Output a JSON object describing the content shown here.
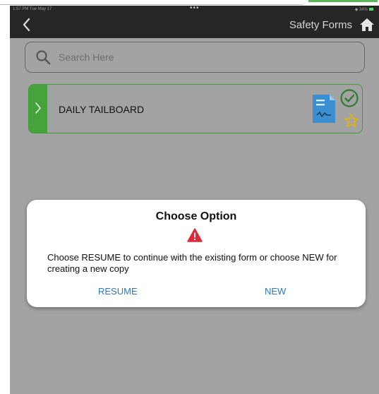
{
  "status_bar": {
    "time": "1:57 PM   Tue May 17",
    "dots": "•••",
    "battery": "◆ 34%"
  },
  "nav": {
    "title": "Safety Forms",
    "back_icon": "chevron-left-icon",
    "home_icon": "home-icon"
  },
  "search": {
    "placeholder": "Search Here",
    "icon": "search-icon"
  },
  "forms": [
    {
      "label": "DAILY TAILBOARD",
      "status": "completed",
      "favorite": false
    }
  ],
  "dialog": {
    "title": "Choose Option",
    "message": "Choose RESUME to continue with the existing form or choose NEW for creating a new copy",
    "resume_label": "RESUME",
    "new_label": "NEW"
  },
  "colors": {
    "nav_background": "#262626",
    "content_background": "#a3a3a3",
    "accent_green": "#46a23d",
    "link_blue": "#2a78c5",
    "warning_red": "#e0293a",
    "star_yellow": "#e8b400"
  }
}
